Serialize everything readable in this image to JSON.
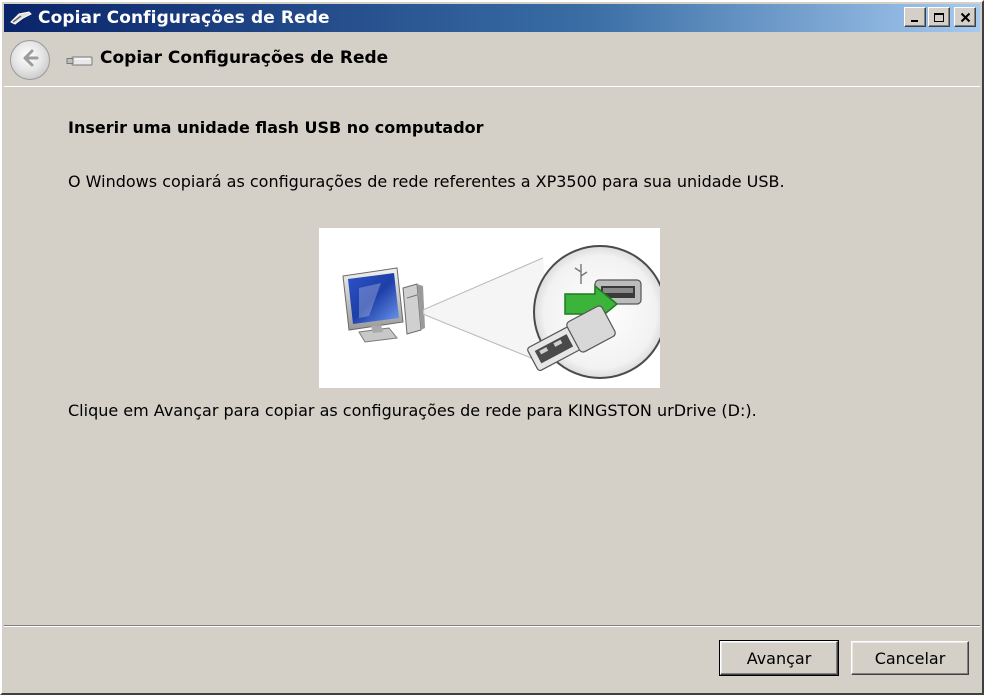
{
  "window": {
    "title": "Copiar Configurações de Rede",
    "title_icon": "network-plug-icon",
    "controls": [
      "minimize-icon",
      "maximize-icon",
      "close-icon"
    ]
  },
  "header": {
    "back_icon": "back-arrow-icon",
    "usb_icon": "usb-drive-icon",
    "title": "Copiar Configurações de Rede"
  },
  "content": {
    "heading": "Inserir uma unidade flash USB no computador",
    "description": "O Windows copiará as configurações de rede referentes a XP3500 para sua unidade USB.",
    "illustration": "computer-usb-insert-illustration",
    "instruction": "Clique em Avançar para copiar as configurações de rede para KINGSTON urDrive (D:)."
  },
  "footer": {
    "next_label": "Avançar",
    "cancel_label": "Cancelar"
  },
  "colors": {
    "titlebar_start": "#0a246a",
    "titlebar_end": "#a6caf0",
    "face": "#d4d0c8",
    "arrow_green": "#3cb43c"
  }
}
